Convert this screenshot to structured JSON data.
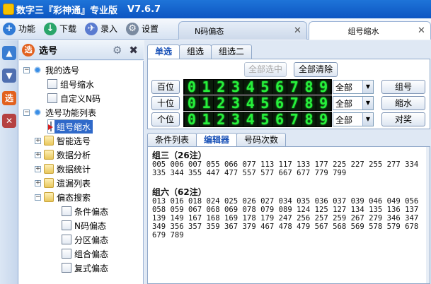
{
  "titlebar": {
    "app_name": "数字三『彩神通』专业版",
    "version": "V7.6.7"
  },
  "toolbar": [
    {
      "label": "功能",
      "icon": "plus-icon",
      "color": "#2f7ad6"
    },
    {
      "label": "下载",
      "icon": "download-icon",
      "color": "#2aa56a"
    },
    {
      "label": "录入",
      "icon": "airplane-icon",
      "color": "#5a7bd0"
    },
    {
      "label": "设置",
      "icon": "gears-icon",
      "color": "#7a8aa0"
    }
  ],
  "doc_tabs": [
    {
      "label": "N码偏态"
    },
    {
      "label": "组号缩水"
    }
  ],
  "panel": {
    "title": "选号"
  },
  "tree": [
    {
      "label": "我的选号"
    },
    {
      "label": "组号缩水"
    },
    {
      "label": "自定义N码"
    },
    {
      "label": "选号功能列表"
    },
    {
      "label": "组号缩水"
    },
    {
      "label": "智能选号"
    },
    {
      "label": "数据分析"
    },
    {
      "label": "数据统计"
    },
    {
      "label": "遗漏列表"
    },
    {
      "label": "偏态搜索"
    },
    {
      "label": "条件偏态"
    },
    {
      "label": "N码偏态"
    },
    {
      "label": "分区偏态"
    },
    {
      "label": "组合偏态"
    },
    {
      "label": "复式偏态"
    }
  ],
  "top_tabs": [
    "单选",
    "组选",
    "组选二"
  ],
  "buttons": {
    "select_all": "全部选中",
    "clear_all": "全部清除",
    "group": "组号",
    "shrink": "缩水",
    "award": "对奖"
  },
  "rows": [
    {
      "label": "百位",
      "option": "全部"
    },
    {
      "label": "十位",
      "option": "全部"
    },
    {
      "label": "个位",
      "option": "全部"
    }
  ],
  "digits": [
    "0",
    "1",
    "2",
    "3",
    "4",
    "5",
    "6",
    "7",
    "8",
    "9"
  ],
  "bottom_tabs": [
    "条件列表",
    "编辑器",
    "号码次数"
  ],
  "editor": {
    "group3_header": "组三（26注）",
    "group3_lines": [
      "005 006 007 055 066 077 113 117 133 177 225 227 255 277 334",
      "335 344 355 447 477 557 577 667 677 779 799"
    ],
    "group6_header": "组六（62注）",
    "group6_lines": [
      "013 016 018 024 025 026 027 034 035 036 037 039 046 049 056",
      "058 059 067 068 069 078 079 089 124 125 127 134 135 136 137",
      "139 149 167 168 169 178 179 247 256 257 259 267 279 346 347",
      "349 356 357 359 367 379 467 478 479 567 568 569 578 579 678",
      "679 789"
    ]
  }
}
